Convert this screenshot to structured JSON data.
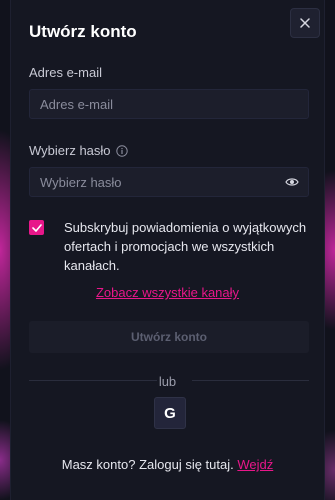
{
  "modal": {
    "title": "Utwórz konto",
    "close_icon": "close-icon"
  },
  "email": {
    "label": "Adres e-mail",
    "placeholder": "Adres e-mail",
    "value": ""
  },
  "password": {
    "label": "Wybierz hasło",
    "placeholder": "Wybierz hasło",
    "value": "",
    "info_icon": "info-icon",
    "toggle_icon": "eye-icon"
  },
  "subscribe": {
    "checked": true,
    "text": "Subskrybuj powiadomienia o wyjątkowych ofertach i promocjach we wszystkich kanałach.",
    "link": "Zobacz wszystkie kanały"
  },
  "submit": {
    "label": "Utwórz konto",
    "disabled": true
  },
  "divider": {
    "text": "lub"
  },
  "social": {
    "google_label": "G"
  },
  "footer": {
    "text": "Masz konto? Zaloguj się tutaj.",
    "link": "Wejdź"
  },
  "colors": {
    "accent": "#e8178a",
    "modal_bg": "#151722",
    "input_bg": "#1c1e2b"
  }
}
